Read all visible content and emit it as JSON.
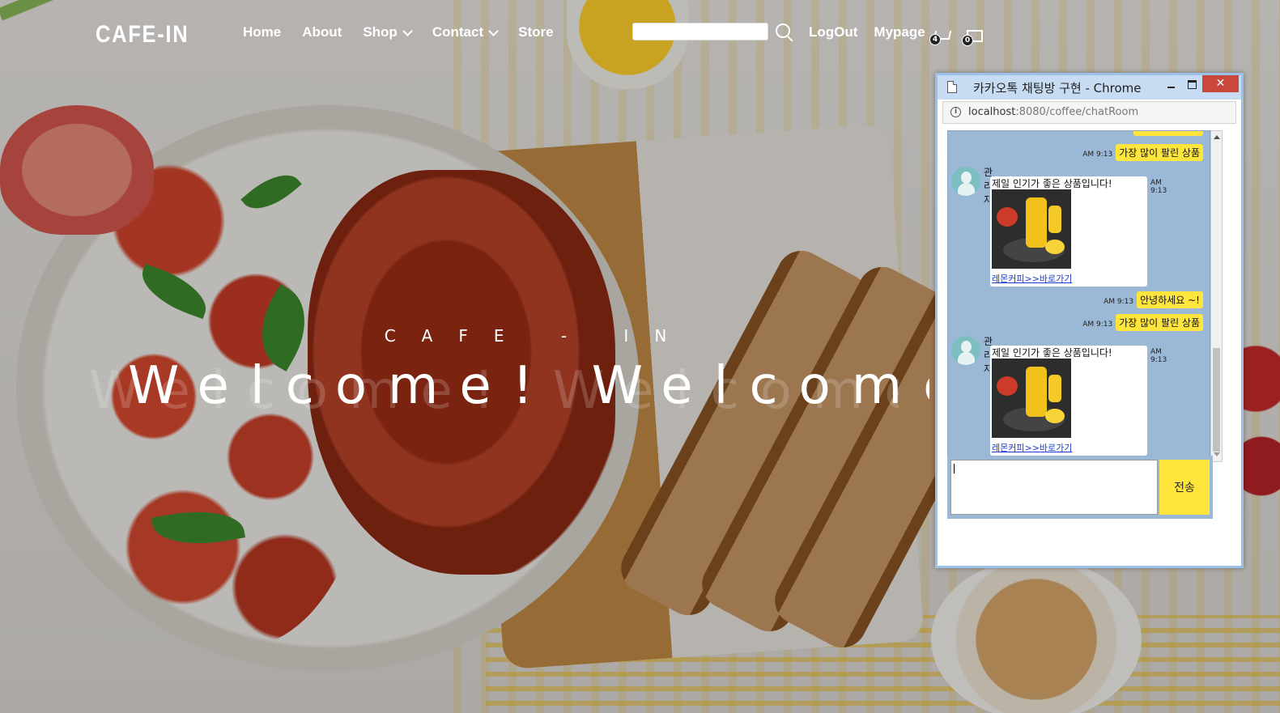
{
  "brand": {
    "logo": "CAFE-IN"
  },
  "nav": {
    "items": [
      {
        "label": "Home",
        "has_dropdown": false
      },
      {
        "label": "About",
        "has_dropdown": false
      },
      {
        "label": "Shop",
        "has_dropdown": true
      },
      {
        "label": "Contact",
        "has_dropdown": true
      },
      {
        "label": "Store",
        "has_dropdown": false
      }
    ],
    "search": {
      "value": "",
      "placeholder": ""
    },
    "user_links": {
      "logout": "LogOut",
      "mypage": "Mypage"
    },
    "cart_count": "4",
    "message_count": "0"
  },
  "hero": {
    "subtitle": "CAFE - IN",
    "title": "Welcome! Welcome",
    "ghost_title": "Welcome! Welcome"
  },
  "chat_window": {
    "title": "카카오톡 채팅방 구현 - Chrome",
    "url_host": "localhost",
    "url_rest": ":8080/coffee/chatRoom",
    "send_label": "전송",
    "compose_value": "",
    "messages": [
      {
        "side": "right",
        "time": "AM 9:13",
        "text": "가장 많이 팔린 상품"
      },
      {
        "side": "left",
        "sender": "관리자",
        "time": "AM 9:13",
        "text": "제일 인기가 좋은 상품입니다!",
        "link": "레몬커피>>바로가기"
      },
      {
        "side": "right",
        "time": "AM 9:13",
        "text": "안녕하세요 ~!"
      },
      {
        "side": "right",
        "time": "AM 9:13",
        "text": "가장 많이 팔린 상품"
      },
      {
        "side": "left",
        "sender": "관리자",
        "time": "AM 9:13",
        "text": "제일 인기가 좋은 상품입니다!",
        "link": "레몬커피>>바로가기"
      }
    ]
  },
  "colors": {
    "chat_bg": "#9bb9d6",
    "bubble_yellow": "#ffe53c",
    "titlebar": "#c7dcf2",
    "close_red": "#c9483b",
    "link_blue": "#1a3dd1"
  }
}
